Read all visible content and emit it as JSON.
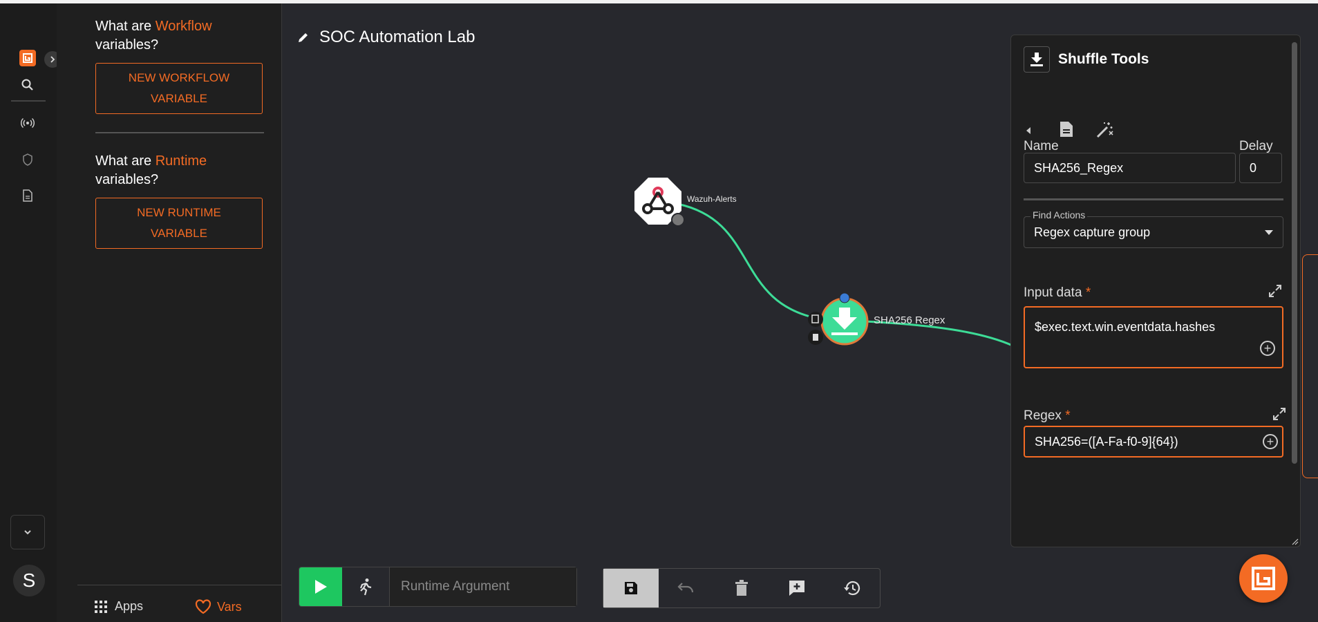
{
  "workflow": {
    "title": "SOC Automation Lab"
  },
  "variables_panel": {
    "workflow_q_prefix": "What are ",
    "workflow_q_highlight": "Workflow",
    "workflow_q_suffix": "variables?",
    "new_workflow_var": "NEW WORKFLOW VARIABLE",
    "runtime_q_prefix": "What are ",
    "runtime_q_highlight": "Runtime",
    "runtime_q_suffix": "variables?",
    "new_runtime_var": "NEW RUNTIME VARIABLE",
    "tab_apps": "Apps",
    "tab_vars": "Vars"
  },
  "user": {
    "avatar_letter": "S"
  },
  "nodes": {
    "trigger_label": "Wazuh-Alerts",
    "action_label": "SHA256 Regex"
  },
  "toolbar": {
    "runtime_placeholder": "Runtime Argument"
  },
  "config": {
    "app_name": "Shuffle Tools",
    "name_label": "Name",
    "name_value": "SHA256_Regex",
    "delay_label": "Delay",
    "delay_value": "0",
    "find_actions_label": "Find Actions",
    "action_value": "Regex capture group",
    "input_label": "Input data",
    "input_value": "$exec.text.win.eventdata.hashes",
    "regex_label": "Regex",
    "regex_value": "SHA256=([A-Fa-f0-9]{64})",
    "required_mark": "*"
  },
  "colors": {
    "accent": "#f36b24",
    "run": "#1ec760",
    "edge": "#3ddc97"
  }
}
